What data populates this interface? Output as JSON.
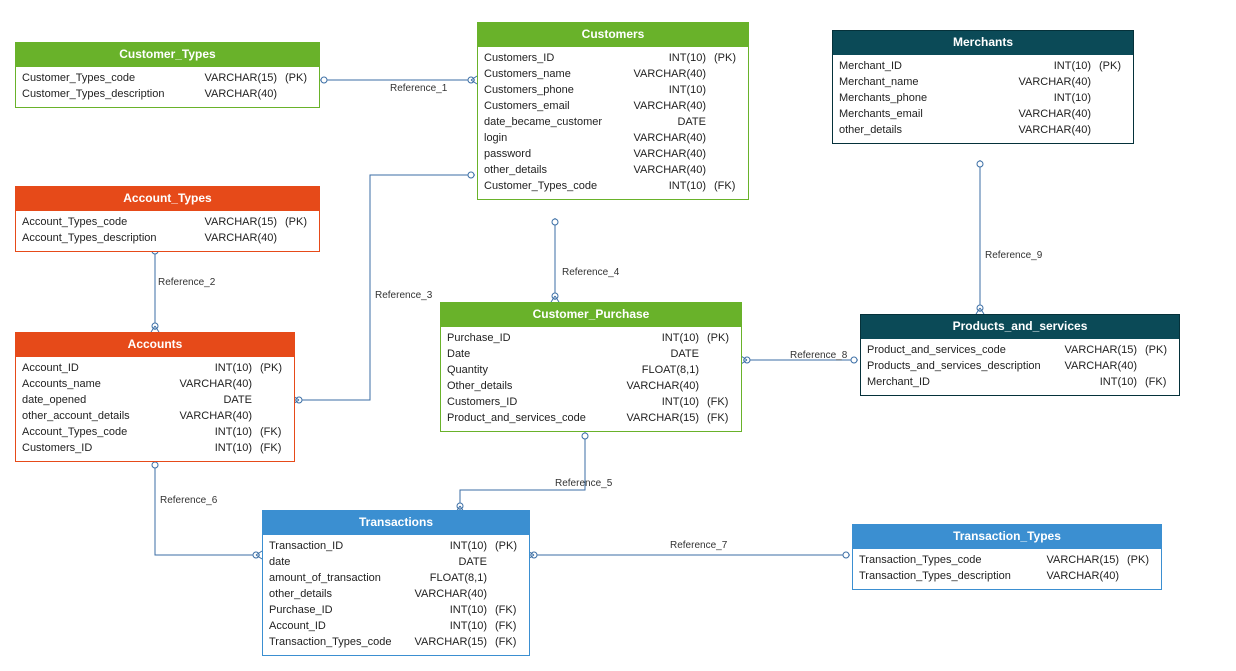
{
  "entities": {
    "customer_types": {
      "title": "Customer_Types",
      "columns": [
        {
          "name": "Customer_Types_code",
          "type": "VARCHAR(15)",
          "key": "(PK)"
        },
        {
          "name": "Customer_Types_description",
          "type": "VARCHAR(40)",
          "key": ""
        }
      ]
    },
    "account_types": {
      "title": "Account_Types",
      "columns": [
        {
          "name": "Account_Types_code",
          "type": "VARCHAR(15)",
          "key": "(PK)"
        },
        {
          "name": "Account_Types_description",
          "type": "VARCHAR(40)",
          "key": ""
        }
      ]
    },
    "accounts": {
      "title": "Accounts",
      "columns": [
        {
          "name": "Account_ID",
          "type": "INT(10)",
          "key": "(PK)"
        },
        {
          "name": "Accounts_name",
          "type": "VARCHAR(40)",
          "key": ""
        },
        {
          "name": "date_opened",
          "type": "DATE",
          "key": ""
        },
        {
          "name": "other_account_details",
          "type": "VARCHAR(40)",
          "key": ""
        },
        {
          "name": "Account_Types_code",
          "type": "INT(10)",
          "key": "(FK)"
        },
        {
          "name": "Customers_ID",
          "type": "INT(10)",
          "key": "(FK)"
        }
      ]
    },
    "customers": {
      "title": "Customers",
      "columns": [
        {
          "name": "Customers_ID",
          "type": "INT(10)",
          "key": "(PK)"
        },
        {
          "name": "Customers_name",
          "type": "VARCHAR(40)",
          "key": ""
        },
        {
          "name": "Customers_phone",
          "type": "INT(10)",
          "key": ""
        },
        {
          "name": "Customers_email",
          "type": "VARCHAR(40)",
          "key": ""
        },
        {
          "name": "date_became_customer",
          "type": "DATE",
          "key": ""
        },
        {
          "name": "login",
          "type": "VARCHAR(40)",
          "key": ""
        },
        {
          "name": "password",
          "type": "VARCHAR(40)",
          "key": ""
        },
        {
          "name": "other_details",
          "type": "VARCHAR(40)",
          "key": ""
        },
        {
          "name": "Customer_Types_code",
          "type": "INT(10)",
          "key": "(FK)"
        }
      ]
    },
    "customer_purchase": {
      "title": "Customer_Purchase",
      "columns": [
        {
          "name": "Purchase_ID",
          "type": "INT(10)",
          "key": "(PK)"
        },
        {
          "name": "Date",
          "type": "DATE",
          "key": ""
        },
        {
          "name": "Quantity",
          "type": "FLOAT(8,1)",
          "key": ""
        },
        {
          "name": "Other_details",
          "type": "VARCHAR(40)",
          "key": ""
        },
        {
          "name": "Customers_ID",
          "type": "INT(10)",
          "key": "(FK)"
        },
        {
          "name": "Product_and_services_code",
          "type": "VARCHAR(15)",
          "key": "(FK)"
        }
      ]
    },
    "merchants": {
      "title": "Merchants",
      "columns": [
        {
          "name": "Merchant_ID",
          "type": "INT(10)",
          "key": "(PK)"
        },
        {
          "name": "Merchant_name",
          "type": "VARCHAR(40)",
          "key": ""
        },
        {
          "name": "Merchants_phone",
          "type": "INT(10)",
          "key": ""
        },
        {
          "name": "Merchants_email",
          "type": "VARCHAR(40)",
          "key": ""
        },
        {
          "name": "other_details",
          "type": "VARCHAR(40)",
          "key": ""
        }
      ]
    },
    "products_services": {
      "title": "Products_and_services",
      "columns": [
        {
          "name": "Product_and_services_code",
          "type": "VARCHAR(15)",
          "key": "(PK)"
        },
        {
          "name": "Products_and_services_description",
          "type": "VARCHAR(40)",
          "key": ""
        },
        {
          "name": "Merchant_ID",
          "type": "INT(10)",
          "key": "(FK)"
        }
      ]
    },
    "transactions": {
      "title": "Transactions",
      "columns": [
        {
          "name": "Transaction_ID",
          "type": "INT(10)",
          "key": "(PK)"
        },
        {
          "name": "date",
          "type": "DATE",
          "key": ""
        },
        {
          "name": "amount_of_transaction",
          "type": "FLOAT(8,1)",
          "key": ""
        },
        {
          "name": "other_details",
          "type": "VARCHAR(40)",
          "key": ""
        },
        {
          "name": "Purchase_ID",
          "type": "INT(10)",
          "key": "(FK)"
        },
        {
          "name": "Account_ID",
          "type": "INT(10)",
          "key": "(FK)"
        },
        {
          "name": "Transaction_Types_code",
          "type": "VARCHAR(15)",
          "key": "(FK)"
        }
      ]
    },
    "transaction_types": {
      "title": "Transaction_Types",
      "columns": [
        {
          "name": "Transaction_Types_code",
          "type": "VARCHAR(15)",
          "key": "(PK)"
        },
        {
          "name": "Transaction_Types_description",
          "type": "VARCHAR(40)",
          "key": ""
        }
      ]
    }
  },
  "references": {
    "r1": "Reference_1",
    "r2": "Reference_2",
    "r3": "Reference_3",
    "r4": "Reference_4",
    "r5": "Reference_5",
    "r6": "Reference_6",
    "r7": "Reference_7",
    "r8": "Reference_8",
    "r9": "Reference_9"
  }
}
